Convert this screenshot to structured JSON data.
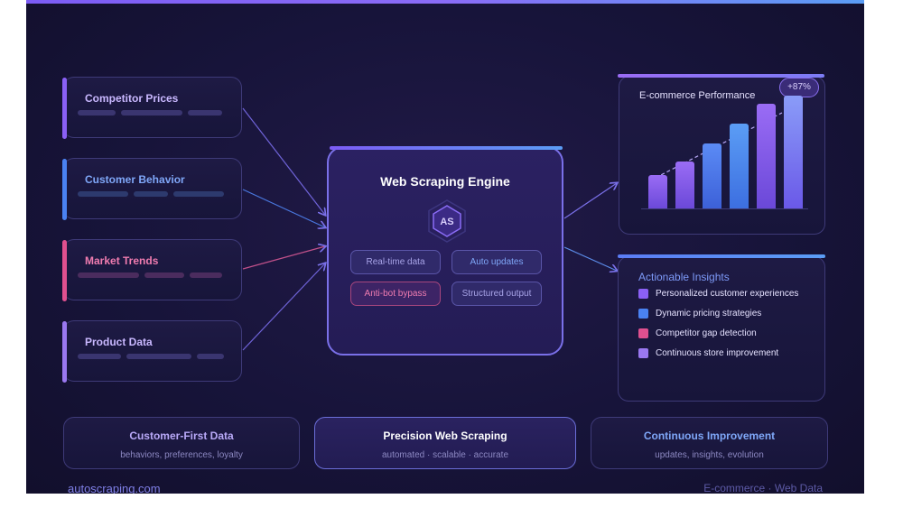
{
  "sources": [
    {
      "title": "Competitor Prices",
      "color": "#8a60f5",
      "text_color": "#c9b8ff",
      "bar_color": "#3a3570"
    },
    {
      "title": "Customer Behavior",
      "color": "#4a82f2",
      "text_color": "#7fa7f8",
      "bar_color": "#2d3a6e"
    },
    {
      "title": "Market Trends",
      "color": "#e0508f",
      "text_color": "#f07cb0",
      "bar_color": "#4b2c5e"
    },
    {
      "title": "Product Data",
      "color": "#9a78f0",
      "text_color": "#c9b8ff",
      "bar_color": "#3a3570"
    }
  ],
  "engine": {
    "title": "Web Scraping Engine",
    "logo": "AS",
    "features": [
      {
        "label": "Real-time data",
        "color": "#a8a4e8"
      },
      {
        "label": "Auto updates",
        "color": "#7fa7f8"
      },
      {
        "label": "Anti-bot bypass",
        "color": "#f07cb0"
      },
      {
        "label": "Structured output",
        "color": "#a8a4e8"
      }
    ]
  },
  "performance": {
    "title": "E-commerce Performance",
    "badge": "+87%",
    "bar_levels": [
      0.3,
      0.42,
      0.58,
      0.75,
      0.93,
      1.0
    ]
  },
  "insights": {
    "title": "Actionable Insights",
    "items": [
      {
        "label": "Personalized customer experiences",
        "color": "#8a60f5"
      },
      {
        "label": "Dynamic pricing strategies",
        "color": "#4a82f2"
      },
      {
        "label": "Competitor gap detection",
        "color": "#e0508f"
      },
      {
        "label": "Continuous store improvement",
        "color": "#9a78f0"
      }
    ]
  },
  "footer": [
    {
      "title": "Customer-First Data",
      "subtitle": "behaviors, preferences, loyalty",
      "color": "#b9a9f8"
    },
    {
      "title": "Precision Web Scraping",
      "subtitle": "automated · scalable · accurate",
      "color": "#ffffff"
    },
    {
      "title": "Continuous Improvement",
      "subtitle": "updates, insights, evolution",
      "color": "#7fa7f8"
    }
  ],
  "brand": "autoscraping.com",
  "tagline": "E-commerce · Web Data"
}
